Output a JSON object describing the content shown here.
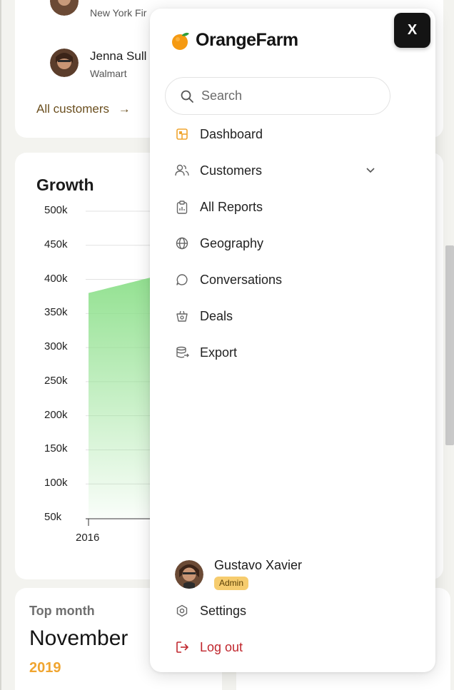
{
  "customers_card": {
    "rows": [
      {
        "name": "",
        "company": "New York Fir"
      },
      {
        "name": "Jenna Sull",
        "company": "Walmart"
      }
    ],
    "all_customers_label": "All customers",
    "arrow": "→"
  },
  "growth": {
    "title": "Growth",
    "chart_data": {
      "type": "area",
      "title": "Growth",
      "xlabel": "",
      "ylabel": "",
      "y_ticks": [
        "500k",
        "450k",
        "400k",
        "350k",
        "300k",
        "250k",
        "200k",
        "150k",
        "100k",
        "50k"
      ],
      "x_ticks": [
        "2016"
      ],
      "ylim": [
        50000,
        500000
      ],
      "x": [
        "2016"
      ],
      "series": [
        {
          "values": [
            380000
          ]
        }
      ],
      "grid": true,
      "color": "#8ee08c"
    }
  },
  "top_month": {
    "label": "Top month",
    "month": "November",
    "year": "2019"
  },
  "menu": {
    "brand": "OrangeFarm",
    "close_label": "X",
    "search_placeholder": "Search",
    "items": [
      {
        "label": "Dashboard",
        "icon": "dashboard-icon"
      },
      {
        "label": "Customers",
        "icon": "users-icon"
      },
      {
        "label": "All Reports",
        "icon": "clipboard-icon"
      },
      {
        "label": "Geography",
        "icon": "globe-icon"
      },
      {
        "label": "Conversations",
        "icon": "chat-icon"
      },
      {
        "label": "Deals",
        "icon": "basket-icon"
      },
      {
        "label": "Export",
        "icon": "database-export-icon"
      }
    ],
    "user": {
      "name": "Gustavo Xavier",
      "role": "Admin"
    },
    "settings_label": "Settings",
    "logout_label": "Log out"
  },
  "colors": {
    "accent": "#f0a530",
    "danger": "#c0262d",
    "chart_green": "#8ee08c"
  }
}
